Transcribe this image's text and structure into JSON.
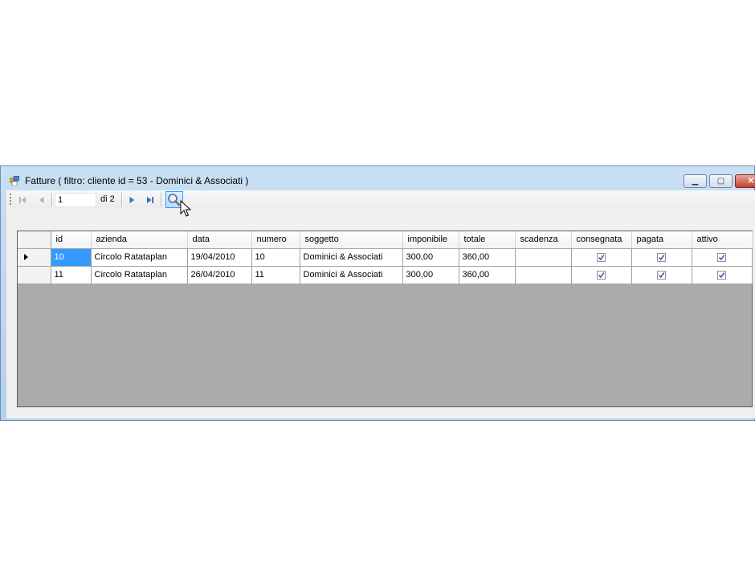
{
  "window": {
    "title": "Fatture ( filtro: cliente id = 53 - Dominici & Associati  )",
    "minimize_glyph": "▁",
    "maximize_glyph": "▢",
    "close_glyph": "✕"
  },
  "toolbar": {
    "first_icon": "move-first-icon",
    "previous_icon": "move-previous-icon",
    "position_value": "1",
    "count_label": "di 2",
    "next_icon": "move-next-icon",
    "last_icon": "move-last-icon",
    "search_icon": "search-icon"
  },
  "grid": {
    "columns": [
      "id",
      "azienda",
      "data",
      "numero",
      "soggetto",
      "imponibile",
      "totale",
      "scadenza",
      "consegnata",
      "pagata",
      "attivo"
    ],
    "rows": [
      {
        "current": true,
        "id": "10",
        "azienda": "Circolo Ratataplan",
        "data": "19/04/2010",
        "numero": "10",
        "soggetto": "Dominici & Associati",
        "imponibile": "300,00",
        "totale": "360,00",
        "scadenza": "",
        "consegnata": true,
        "pagata": true,
        "attivo": true
      },
      {
        "current": false,
        "id": "11",
        "azienda": "Circolo Ratataplan",
        "data": "26/04/2010",
        "numero": "11",
        "soggetto": "Dominici & Associati",
        "imponibile": "300,00",
        "totale": "360,00",
        "scadenza": "",
        "consegnata": true,
        "pagata": true,
        "attivo": true
      }
    ]
  },
  "colors": {
    "selection": "#3399ff",
    "grid_background": "#ababab",
    "title_bar": "#c9dff2"
  }
}
